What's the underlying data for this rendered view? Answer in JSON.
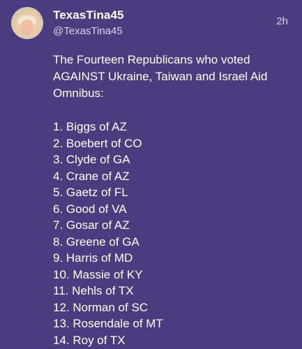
{
  "post": {
    "display_name": "TexasTina45",
    "handle": "@TexasTina45",
    "time": "2h",
    "intro_lines": [
      "The Fourteen Republicans who voted",
      "AGAINST Ukraine, Taiwan and Israel Aid",
      "Omnibus:"
    ],
    "list": [
      "1. Biggs of AZ",
      "2. Boebert of CO",
      "3. Clyde of GA",
      "4. Crane of AZ",
      "5. Gaetz of FL",
      "6. Good of VA",
      "7. Gosar of AZ",
      "8. Greene of GA",
      "9. Harris of MD",
      "10. Massie of KY",
      "11. Nehls of TX",
      "12. Norman of SC",
      "13. Rosendale of MT",
      "14. Roy of TX"
    ]
  },
  "colors": {
    "background": "#4a3d7f",
    "text": "#ffffff",
    "secondary_text": "#d9d4ec"
  }
}
